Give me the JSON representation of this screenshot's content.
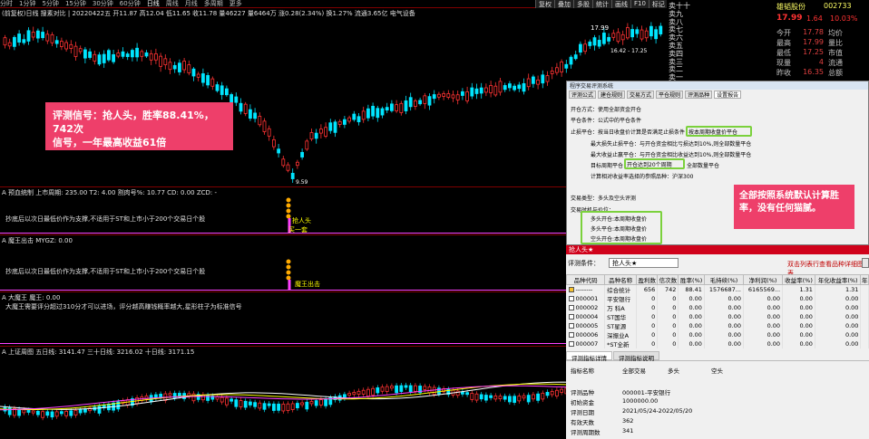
{
  "toolbar": {
    "periods": [
      "分时",
      "1分钟",
      "5分钟",
      "15分钟",
      "30分钟",
      "60分钟",
      "日线",
      "周线",
      "月线",
      "多周期",
      "更多"
    ],
    "selected": "日线",
    "right_buttons": [
      "复权",
      "叠加",
      "多股",
      "统计",
      "画线",
      "F10",
      "标记",
      "-"
    ]
  },
  "main_legend": "(前复权)日线 搜素对比 | 20220422五 开11.87 高12.04 低11.65 收11.78 量46227 量6464万 涨0.28(2.34%) 换1.27% 流通3.65亿 电气设备",
  "chart_price_labels": {
    "top": "17.99",
    "range": "16.42 - 17.25",
    "low": "9.59"
  },
  "promo": {
    "line1": "评测信号：抢人头，胜率88.41%，742次",
    "line2": "信号，一年最高收益61倍"
  },
  "panel1": {
    "legend": "A 预血统制  上市周期: 235.00  T2: 4.00  割肉号%: 10.77  CD: 0.00  ZCD: -",
    "desc": "抄底后以次日最低价作为支撑,不适用于ST和上市小于200个交易日个股",
    "signal1": "抢人头",
    "signal2": "买一套"
  },
  "panel2": {
    "legend": "A 魔王出击  MYGZ: 0.00",
    "desc": "抄底后以次日最低价作为支撑,不适用于ST和上市小于200个交易日个股",
    "signal": "魔王出击"
  },
  "panel3": {
    "legend": "A 大魔王  魔王: 0.00",
    "desc": "大魔王需要评分超过310分才可以进场，评分越高赚钱概率越大,星形柱子为标准信号"
  },
  "panel4": {
    "legend": "A 上证周图  五日线: 3141.47  三十日线: 3216.02  十日线: 3171.15"
  },
  "book": {
    "rows": [
      "卖十十",
      "卖九",
      "卖八",
      "卖七",
      "卖六",
      "卖五",
      "卖四",
      "卖三",
      "卖二",
      "卖一"
    ]
  },
  "quote": {
    "name": "雄韬股份",
    "code": "002733",
    "price": "17.99",
    "change": "1.64",
    "pct": "10.03%",
    "rows": [
      {
        "k": "今开",
        "v": "17.78",
        "k2": "均价"
      },
      {
        "k": "最高",
        "v": "17.99",
        "k2": "量比"
      },
      {
        "k": "最低",
        "v": "17.25",
        "k2": "市值"
      },
      {
        "k": "现量",
        "v": "4",
        "k2": "流通"
      },
      {
        "k": "昨收",
        "v": "16.35",
        "k2": "总额"
      }
    ]
  },
  "dialog": {
    "title": "程序交易评测系统",
    "tabs": [
      "评测公式",
      "建仓规则",
      "交易方式",
      "平仓规则",
      "评测品种",
      "设置报告"
    ],
    "active_tab": "设置报告",
    "lines": [
      "开仓方式：使用全部资金开仓",
      "平仓条件：公式中的平仓条件",
      "止损平仓：按当日收盘价计算是否满足止损条件",
      "最大损失止损平仓：与开仓资金相比亏损达到10%,则全部数量平仓",
      "最大收益止赢平仓：与开仓资金相比收益达到10%,则全部数量平仓",
      "目标周期平仓：",
      "计算相对收益率选择的参照品种：沪深300",
      "交易类型：多头及空头评测",
      "交易时机与价位："
    ],
    "stoploss_box": "按本周期收盘价平仓",
    "target_box": "开仓达到20个周期",
    "target_tail": "全部数量平仓",
    "timing": [
      "多头开仓:本周期收盘价",
      "多头平仓:本周期收盘价",
      "空头开仓:本周期收盘价"
    ]
  },
  "callout": {
    "line1": "全部按照系统默认计算胜",
    "line2": "率，没有任何猫腻。"
  },
  "results": {
    "title": "抢人头★",
    "cond_label": "评测条件：",
    "cond_value": "抢人头★",
    "link": "双击列表行查看品种详细图表",
    "columns": [
      "品种代码",
      "品种名称",
      "盈利数",
      "信次数",
      "胜率(%)",
      "毛持续(%)",
      "净利润(%)",
      "收益率(%)",
      "年化收益率(%)",
      "年"
    ],
    "rows": [
      [
        "--------",
        "综合统计",
        "656",
        "742",
        "88.41",
        "1576687...",
        "6165569...",
        "1.31",
        "1.31"
      ],
      [
        "000001",
        "平安银行",
        "0",
        "0",
        "0.00",
        "0.00",
        "0.00",
        "0.00",
        "0.00"
      ],
      [
        "000002",
        "万 科A",
        "0",
        "0",
        "0.00",
        "0.00",
        "0.00",
        "0.00",
        "0.00"
      ],
      [
        "000004",
        "ST国华",
        "0",
        "0",
        "0.00",
        "0.00",
        "0.00",
        "0.00",
        "0.00"
      ],
      [
        "000005",
        "ST星源",
        "0",
        "0",
        "0.00",
        "0.00",
        "0.00",
        "0.00",
        "0.00"
      ],
      [
        "000006",
        "深振业A",
        "0",
        "0",
        "0.00",
        "0.00",
        "0.00",
        "0.00",
        "0.00"
      ],
      [
        "000007",
        "*ST全新",
        "0",
        "0",
        "0.00",
        "0.00",
        "0.00",
        "0.00",
        "0.00"
      ]
    ],
    "subtabs": [
      "评测指标详情",
      "评测指标说明"
    ],
    "detail_headers": [
      "指标名称",
      "全部交易",
      "多头",
      "空头"
    ],
    "details": [
      {
        "k": "评测品种",
        "v": "000001-平安银行"
      },
      {
        "k": "初始资金",
        "v": "1000000.00"
      },
      {
        "k": "评测日期",
        "v": "2021/05/24-2022/05/20"
      },
      {
        "k": "有效天数",
        "v": "362"
      },
      {
        "k": "评测周期数",
        "v": "341"
      }
    ]
  },
  "colors": {
    "up": "#ff3333",
    "down": "#00e5ff",
    "highlight": "#ee3f6a",
    "box": "#7bd13c"
  }
}
